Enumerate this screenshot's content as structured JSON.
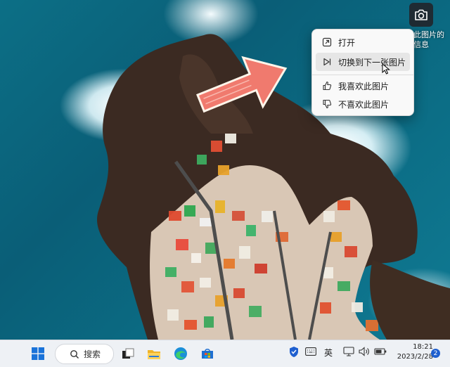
{
  "camera": {
    "caption": "此图片的信息",
    "icon": "camera-icon"
  },
  "context_menu": {
    "items": [
      {
        "label": "打开",
        "icon": "open-external-icon"
      },
      {
        "label": "切换到下一张图片",
        "icon": "next-image-icon"
      },
      {
        "label": "我喜欢此图片",
        "icon": "thumbs-up-icon"
      },
      {
        "label": "不喜欢此图片",
        "icon": "thumbs-down-icon"
      }
    ]
  },
  "taskbar": {
    "search_label": "搜索",
    "input_method": "英",
    "time": "18:21",
    "date": "2023/2/28",
    "notification_count": "2",
    "colors": {
      "accent": "#1e5fcf"
    }
  }
}
